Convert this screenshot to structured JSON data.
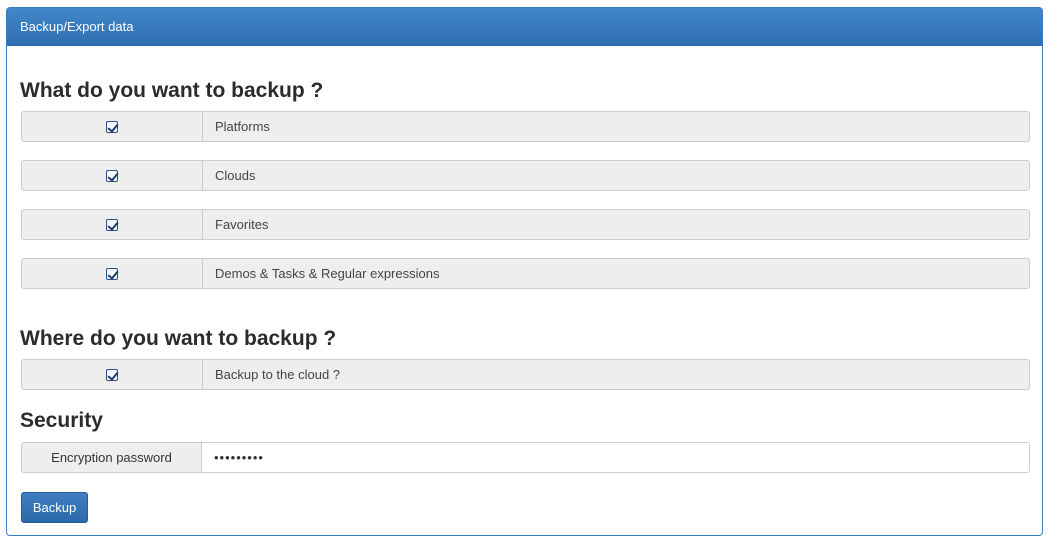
{
  "panel": {
    "title": "Backup/Export data"
  },
  "what": {
    "title": "What do you want to backup ?",
    "items": [
      {
        "label": "Platforms",
        "checked": true
      },
      {
        "label": "Clouds",
        "checked": true
      },
      {
        "label": "Favorites",
        "checked": true
      },
      {
        "label": "Demos & Tasks & Regular expressions",
        "checked": true
      }
    ]
  },
  "where": {
    "title": "Where do you want to backup ?",
    "items": [
      {
        "label": "Backup to the cloud ?",
        "checked": true
      }
    ]
  },
  "security": {
    "title": "Security",
    "password_label": "Encryption password",
    "password_value": "•••••••••"
  },
  "actions": {
    "backup_label": "Backup"
  },
  "icons": {
    "checkbox": "checkbox-checked-icon"
  },
  "colors": {
    "accent": "#2f6fb1",
    "row_bg": "#eeeeee",
    "border": "#cccccc"
  }
}
